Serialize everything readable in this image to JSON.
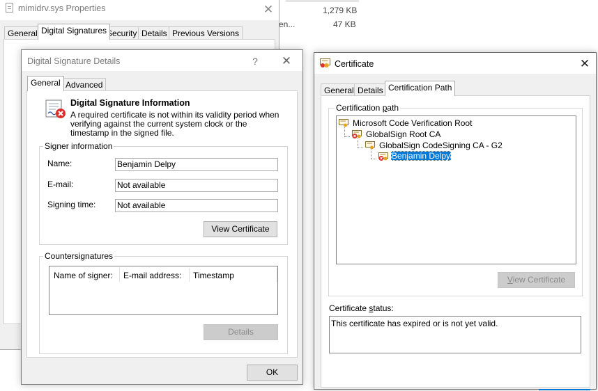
{
  "background_list": {
    "rows": [
      {
        "name": "",
        "size": "1,279 KB"
      },
      {
        "name": "en...",
        "size": "47 KB"
      }
    ]
  },
  "properties_window": {
    "title": "mimidrv.sys Properties",
    "close_glyph": "✕",
    "tabs": [
      "General",
      "Digital Signatures",
      "Security",
      "Details",
      "Previous Versions"
    ]
  },
  "details_dialog": {
    "title": "Digital Signature Details",
    "help_glyph": "?",
    "close_glyph": "✕",
    "tabs": [
      "General",
      "Advanced"
    ],
    "info_heading": "Digital Signature Information",
    "info_text": "A required certificate is not within its validity period when verifying against the current system clock or the timestamp in the signed file.",
    "signer_group_label": "Signer information",
    "name_label": "Name:",
    "name_value": "Benjamin Delpy",
    "email_label": "E-mail:",
    "email_value": "Not available",
    "signing_time_label": "Signing time:",
    "signing_time_value": "Not available",
    "view_certificate_button": "View Certificate",
    "countersignatures_label": "Countersignatures",
    "counter_columns": [
      "Name of signer:",
      "E-mail address:",
      "Timestamp"
    ],
    "details_button": "Details",
    "ok_button": "OK"
  },
  "certificate_dialog": {
    "title": "Certificate",
    "close_glyph": "✕",
    "tabs": [
      "General",
      "Details",
      "Certification Path"
    ],
    "path_label_pre": "Certification ",
    "path_label_accel": "p",
    "path_label_post": "ath",
    "tree": [
      {
        "label": "Microsoft Code Verification Root",
        "level": 0,
        "status": "ok"
      },
      {
        "label": "GlobalSign Root CA",
        "level": 1,
        "status": "error"
      },
      {
        "label": "GlobalSign CodeSigning CA - G2",
        "level": 2,
        "status": "ok"
      },
      {
        "label": "Benjamin Delpy",
        "level": 3,
        "status": "error",
        "selected": true
      }
    ],
    "view_certificate_accel": "V",
    "view_certificate_rest": "iew Certificate",
    "status_label_pre": "Certificate ",
    "status_label_accel": "s",
    "status_label_post": "tatus:",
    "status_text": "This certificate has expired or is not yet valid."
  },
  "colors": {
    "selection": "#0078d7",
    "error_red": "#d9302c"
  }
}
